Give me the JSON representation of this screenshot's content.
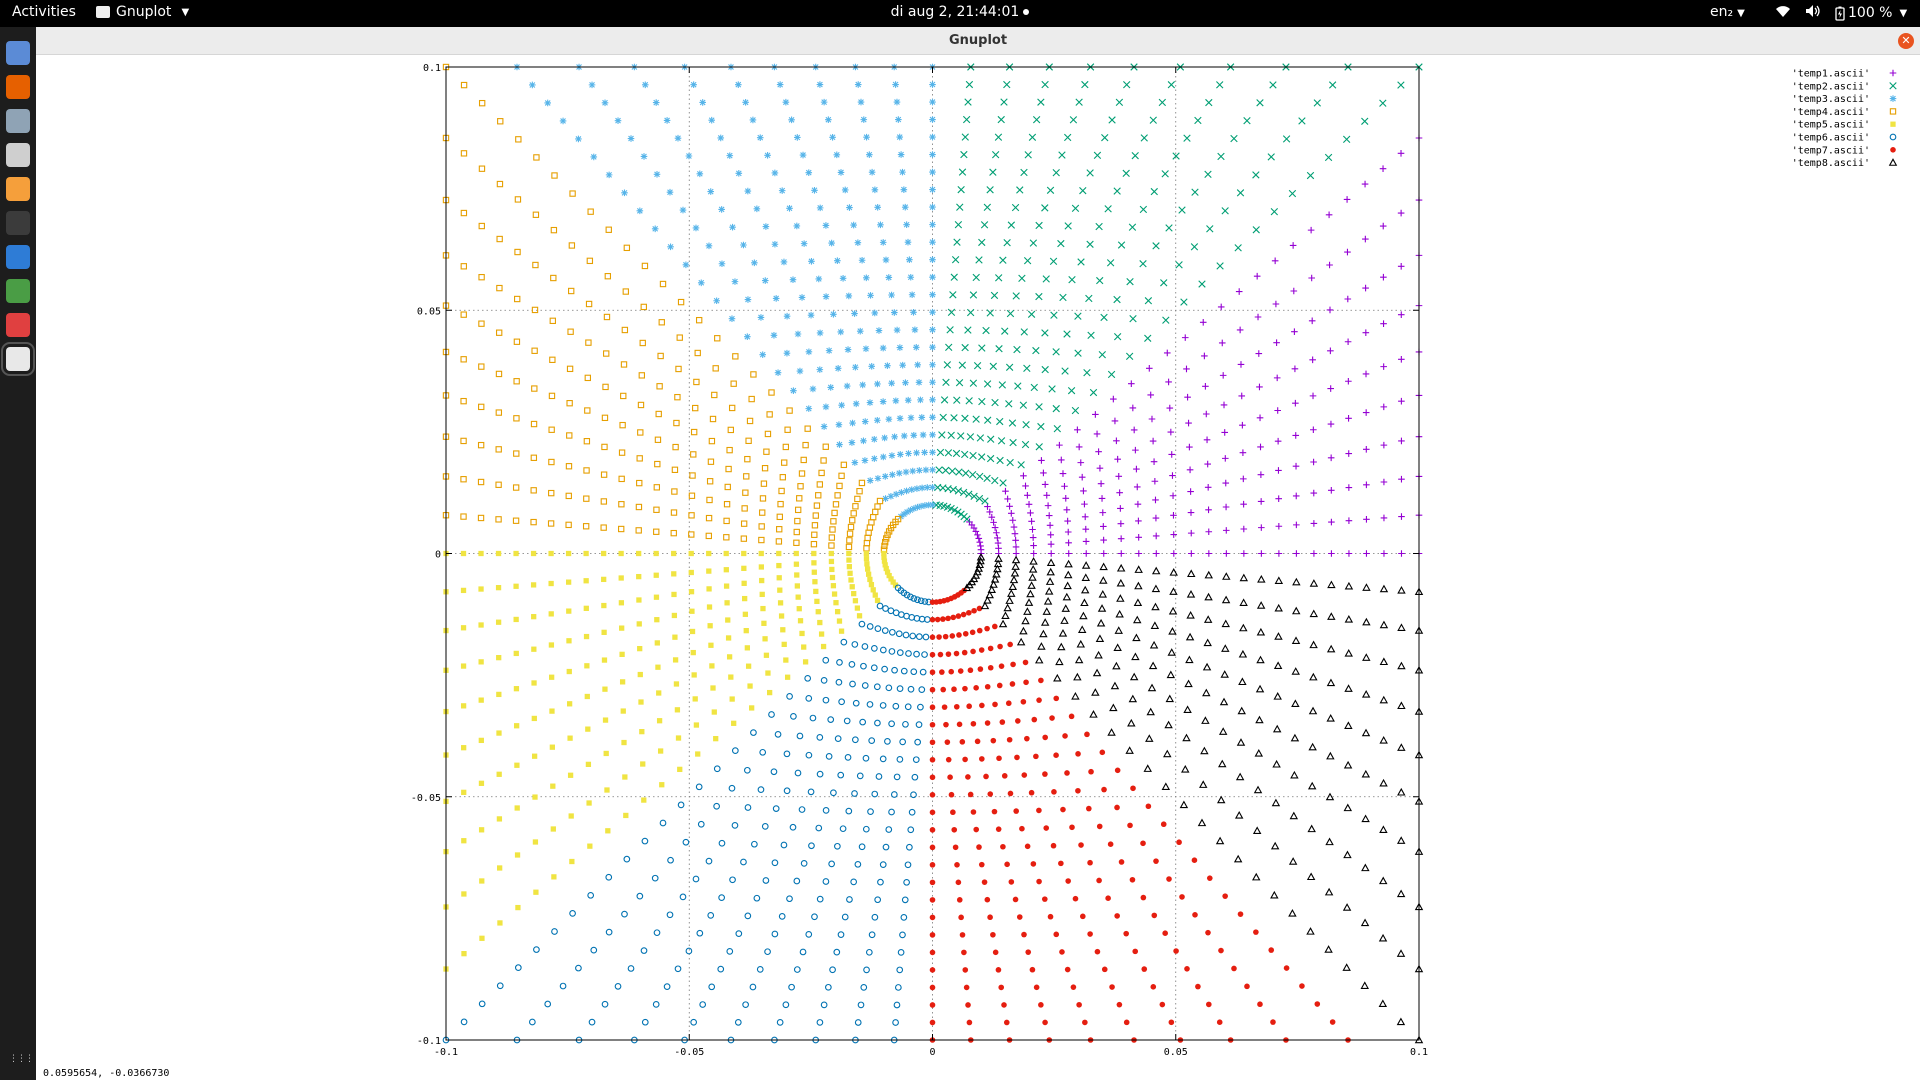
{
  "topbar": {
    "activities": "Activities",
    "app_name": "Gnuplot",
    "clock": "di aug  2, 21:44:01",
    "language": "en₂",
    "battery": "100 %"
  },
  "window": {
    "title": "Gnuplot",
    "status_coords": "0.0595654, -0.0366730"
  },
  "dock": {
    "items": [
      {
        "icon": "files-icon",
        "color": "#5b8bd6"
      },
      {
        "icon": "firefox-icon",
        "color": "#e66000"
      },
      {
        "icon": "disks-icon",
        "color": "#8fa3b5"
      },
      {
        "icon": "tools-icon",
        "color": "#cfcfcf"
      },
      {
        "icon": "night-light-icon",
        "color": "#f59f3b"
      },
      {
        "icon": "terminal-icon",
        "color": "#3b3b3b"
      },
      {
        "icon": "thunderbird-icon",
        "color": "#2e7cd6"
      },
      {
        "icon": "system-monitor-icon",
        "color": "#4a9d45"
      },
      {
        "icon": "gnome-tweaks-icon",
        "color": "#e04040"
      },
      {
        "icon": "gnuplot-window-icon",
        "color": "#e8e8e8"
      }
    ]
  },
  "chart_data": {
    "type": "scatter",
    "title": "",
    "xlabel": "",
    "ylabel": "",
    "xlim": [
      -0.1,
      0.1
    ],
    "ylim": [
      -0.1,
      0.1
    ],
    "x_ticks": [
      "-0.1",
      "-0.05",
      "0",
      "0.05",
      "0.1"
    ],
    "y_ticks": [
      "0.1",
      "0.05",
      "0",
      "-0.05",
      "-0.1"
    ],
    "x_tick_values": [
      -0.1,
      -0.05,
      0,
      0.05,
      0.1
    ],
    "y_tick_values": [
      0.1,
      0.05,
      0,
      -0.05,
      -0.1
    ],
    "grid": true,
    "legend_position": "top-right outside",
    "inner_radius": 0.01,
    "rays_per_octant": 10,
    "points_per_ray": 26,
    "series": [
      {
        "name": "'temp1.ascii'",
        "marker": "plus",
        "color": "#9400d3",
        "angle_range_deg": [
          0,
          45
        ]
      },
      {
        "name": "'temp2.ascii'",
        "marker": "cross",
        "color": "#009e73",
        "angle_range_deg": [
          45,
          90
        ]
      },
      {
        "name": "'temp3.ascii'",
        "marker": "star",
        "color": "#56b4e9",
        "angle_range_deg": [
          90,
          135
        ]
      },
      {
        "name": "'temp4.ascii'",
        "marker": "open-square",
        "color": "#e69f00",
        "angle_range_deg": [
          135,
          180
        ]
      },
      {
        "name": "'temp5.ascii'",
        "marker": "filled-square",
        "color": "#f0e442",
        "angle_range_deg": [
          180,
          225
        ]
      },
      {
        "name": "'temp6.ascii'",
        "marker": "open-circle",
        "color": "#0072b2",
        "angle_range_deg": [
          225,
          270
        ]
      },
      {
        "name": "'temp7.ascii'",
        "marker": "filled-circle",
        "color": "#e51e10",
        "angle_range_deg": [
          270,
          315
        ]
      },
      {
        "name": "'temp8.ascii'",
        "marker": "open-triangle",
        "color": "#000000",
        "angle_range_deg": [
          315,
          360
        ]
      }
    ]
  }
}
